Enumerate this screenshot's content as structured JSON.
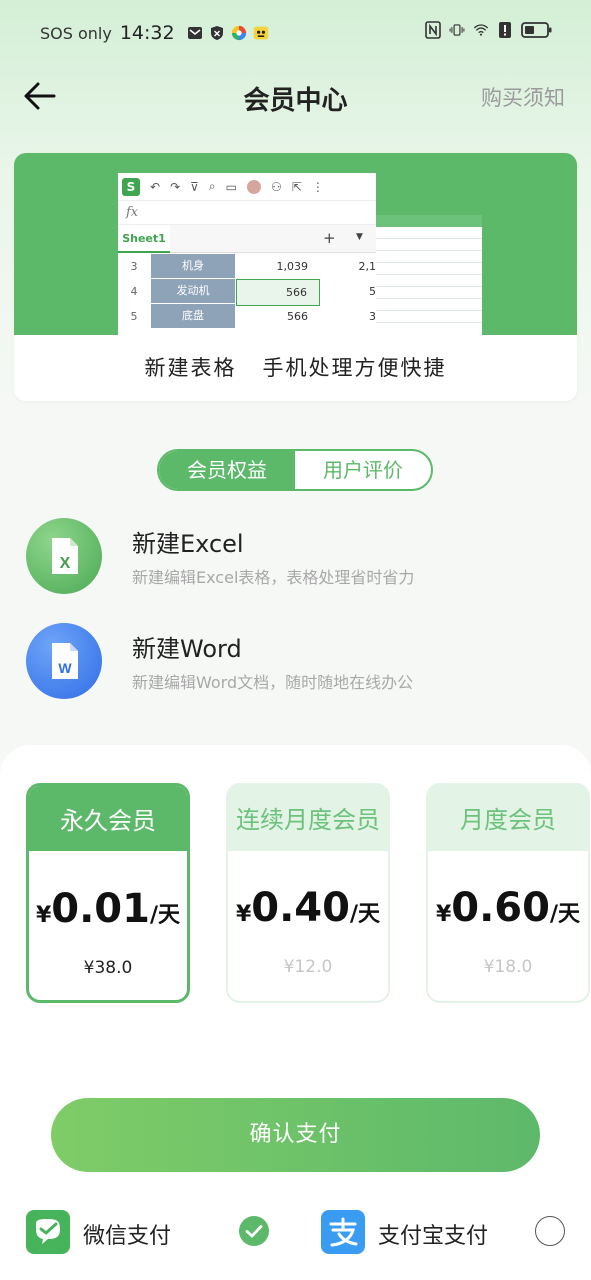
{
  "status_bar": {
    "carrier": "SOS only",
    "time": "14:32"
  },
  "header": {
    "title": "会员中心",
    "notice_link": "购买须知"
  },
  "banner": {
    "caption": "新建表格   手机处理方便快捷",
    "sheet_tab": "Sheet1",
    "fx": "fx",
    "rows": [
      {
        "row": "3",
        "label": "机身",
        "v1": "1,039",
        "v2": "2,1"
      },
      {
        "row": "4",
        "label": "发动机",
        "v1": "566",
        "v2": "5"
      },
      {
        "row": "5",
        "label": "底盘",
        "v1": "566",
        "v2": "3"
      }
    ]
  },
  "tabs": {
    "benefits": "会员权益",
    "reviews": "用户评价"
  },
  "features": [
    {
      "title": "新建Excel",
      "desc": "新建编辑Excel表格，表格处理省时省力",
      "icon": "excel-icon",
      "icon_letter": "X"
    },
    {
      "title": "新建Word",
      "desc": "新建编辑Word文档，随时随地在线办公",
      "icon": "word-icon",
      "icon_letter": "W"
    }
  ],
  "plans": [
    {
      "name": "永久会员",
      "currency": "¥",
      "price": "0.01",
      "unit": "/天",
      "original": "¥38.0",
      "selected": true
    },
    {
      "name": "连续月度会员",
      "currency": "¥",
      "price": "0.40",
      "unit": "/天",
      "original": "¥12.0",
      "selected": false
    },
    {
      "name": "月度会员",
      "currency": "¥",
      "price": "0.60",
      "unit": "/天",
      "original": "¥18.0",
      "selected": false
    }
  ],
  "confirm_button": "确认支付",
  "payment": {
    "wechat": "微信支付",
    "alipay": "支付宝支付",
    "selected": "wechat"
  },
  "colors": {
    "accent": "#5db96a",
    "accent_light": "#e3f3e6",
    "wechat": "#47b35a",
    "alipay": "#3a9cf0"
  }
}
